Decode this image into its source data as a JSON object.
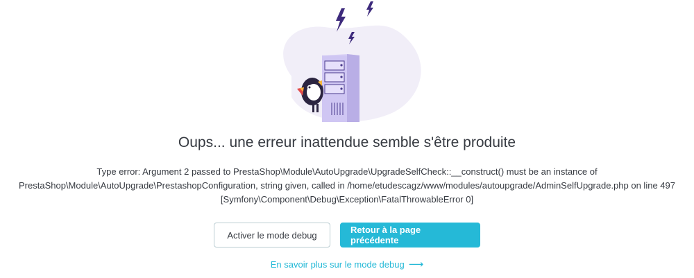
{
  "error": {
    "title": "Oups... une erreur inattendue semble s'être produite",
    "message_lines": [
      "Type error: Argument 2 passed to PrestaShop\\Module\\AutoUpgrade\\UpgradeSelfCheck::__construct() must be an instance of",
      "PrestaShop\\Module\\AutoUpgrade\\PrestashopConfiguration, string given, called in /home/etudescagz/www/modules/autoupgrade/AdminSelfUpgrade.php on line 497",
      "[Symfony\\Component\\Debug\\Exception\\FatalThrowableError 0]"
    ]
  },
  "actions": {
    "debug_label": "Activer le mode debug",
    "back_label": "Retour à la page précédente"
  },
  "learn_more": {
    "label": "En savoir plus sur le mode debug",
    "arrow": "⟶"
  },
  "colors": {
    "accent": "#25b9d7",
    "server": "#c9bff0",
    "blob": "#f1eef8",
    "bolt": "#3d2a7c"
  },
  "icons": [
    "lightning-icon",
    "server-icon",
    "puffin-mascot-icon",
    "arrow-right-icon"
  ]
}
